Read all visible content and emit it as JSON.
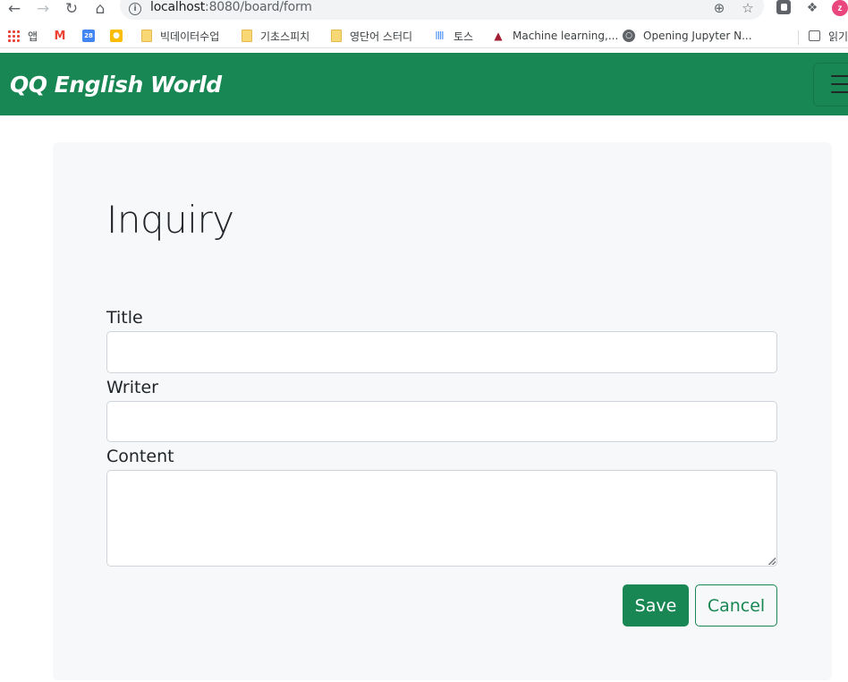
{
  "browser": {
    "url_host": "localhost",
    "url_path": ":8080/board/form",
    "profile_initial": "z",
    "bookmarks": [
      {
        "label": "앱",
        "icon": "apps-grid-icon"
      },
      {
        "label": "",
        "icon": "gmail-icon"
      },
      {
        "label": "",
        "icon": "calendar-icon",
        "icon_text": "28"
      },
      {
        "label": "",
        "icon": "keep-icon"
      },
      {
        "label": "빅데이터수업",
        "icon": "folder-icon"
      },
      {
        "label": "기초스피치",
        "icon": "folder-icon"
      },
      {
        "label": "영단어 스터디",
        "icon": "folder-icon"
      },
      {
        "label": "토스",
        "icon": "toss-icon"
      },
      {
        "label": "Machine learning,...",
        "icon": "mit-icon"
      },
      {
        "label": "Opening Jupyter N...",
        "icon": "globe-icon"
      }
    ],
    "reading_list_label": "읽기"
  },
  "navbar": {
    "brand": "QQ English World",
    "bg_color": "#198754"
  },
  "form": {
    "title": "Inquiry",
    "fields": [
      {
        "label": "Title",
        "value": "",
        "placeholder": ""
      },
      {
        "label": "Writer",
        "value": "",
        "placeholder": ""
      },
      {
        "label": "Content",
        "value": "",
        "placeholder": ""
      }
    ],
    "save_label": "Save",
    "cancel_label": "Cancel"
  }
}
